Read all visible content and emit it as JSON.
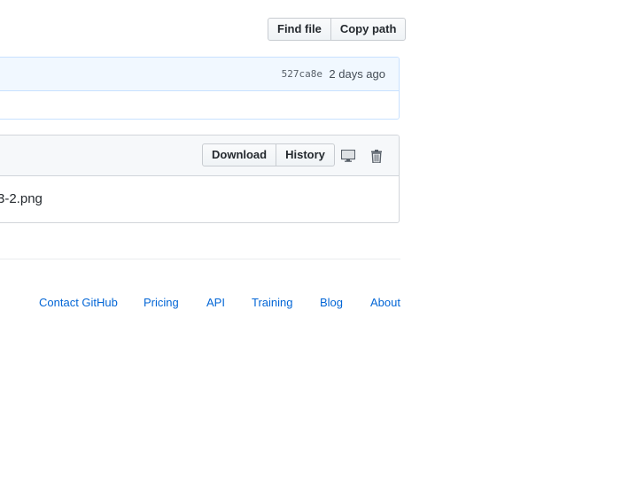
{
  "file_nav": {
    "find_file_label": "Find file",
    "copy_path_label": "Copy path"
  },
  "commit": {
    "sha": "527ca8e",
    "age": "2 days ago"
  },
  "file_header": {
    "download_label": "Download",
    "history_label": "History",
    "icons": [
      "desktop-icon",
      "trash-icon"
    ]
  },
  "file_body": {
    "filename_visible": "3-2.png"
  },
  "footer": {
    "links": [
      "Contact GitHub",
      "Pricing",
      "API",
      "Training",
      "Blog",
      "About"
    ]
  },
  "colors": {
    "link": "#0366d6",
    "commit_bg": "#f1f8ff",
    "header_bg": "#f6f8fa"
  }
}
